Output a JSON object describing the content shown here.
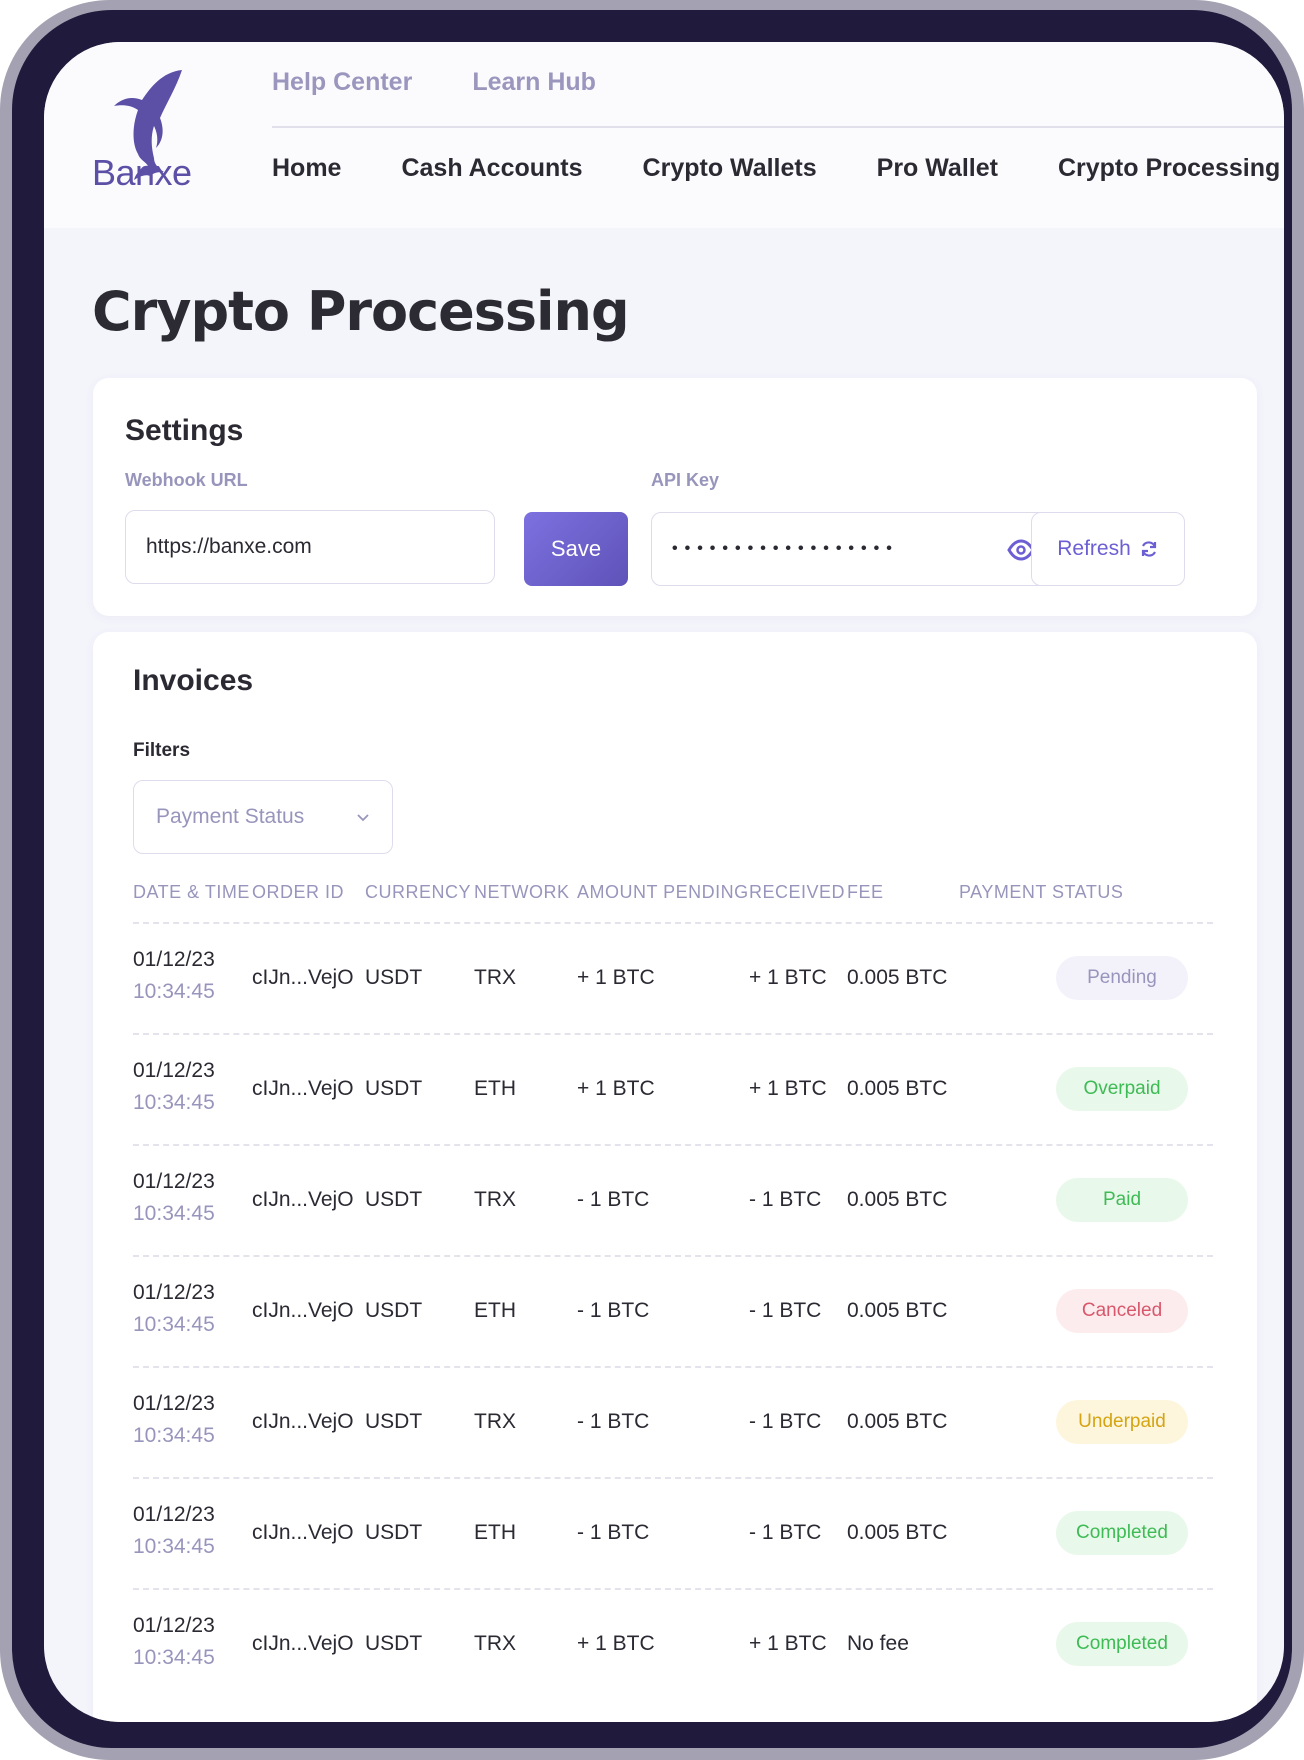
{
  "brand": {
    "name": "Banxe",
    "color": "#5b4fa6"
  },
  "header": {
    "top_links": [
      "Help Center",
      "Learn Hub"
    ],
    "nav": [
      "Home",
      "Cash Accounts",
      "Crypto Wallets",
      "Pro Wallet",
      "Crypto Processing"
    ]
  },
  "page": {
    "title": "Crypto Processing"
  },
  "settings": {
    "title": "Settings",
    "webhook_label": "Webhook URL",
    "webhook_value": "https://banxe.com",
    "save_label": "Save",
    "api_key_label": "API Key",
    "api_key_masked": "••••••••••••••••••",
    "refresh_label": "Refresh"
  },
  "invoices": {
    "title": "Invoices",
    "filters_label": "Filters",
    "filter_select": {
      "placeholder": "Payment Status"
    },
    "columns": [
      "DATE & TIME",
      "ORDER ID",
      "CURRENCY",
      "NETWORK",
      "AMOUNT PENDING",
      "RECEIVED",
      "FEE",
      "PAYMENT STATUS"
    ],
    "rows": [
      {
        "date": "01/12/23",
        "time": "10:34:45",
        "order_id": "cIJn...VejO",
        "currency": "USDT",
        "network": "TRX",
        "amount_pending": "+ 1 BTC",
        "received": "+ 1 BTC",
        "fee": "0.005 BTC",
        "status": "Pending",
        "status_key": "pending"
      },
      {
        "date": "01/12/23",
        "time": "10:34:45",
        "order_id": "cIJn...VejO",
        "currency": "USDT",
        "network": "ETH",
        "amount_pending": "+ 1 BTC",
        "received": "+ 1 BTC",
        "fee": "0.005 BTC",
        "status": "Overpaid",
        "status_key": "success"
      },
      {
        "date": "01/12/23",
        "time": "10:34:45",
        "order_id": "cIJn...VejO",
        "currency": "USDT",
        "network": "TRX",
        "amount_pending": "- 1 BTC",
        "received": "- 1 BTC",
        "fee": "0.005 BTC",
        "status": "Paid",
        "status_key": "success"
      },
      {
        "date": "01/12/23",
        "time": "10:34:45",
        "order_id": "cIJn...VejO",
        "currency": "USDT",
        "network": "ETH",
        "amount_pending": "- 1 BTC",
        "received": "- 1 BTC",
        "fee": "0.005 BTC",
        "status": "Canceled",
        "status_key": "danger"
      },
      {
        "date": "01/12/23",
        "time": "10:34:45",
        "order_id": "cIJn...VejO",
        "currency": "USDT",
        "network": "TRX",
        "amount_pending": "- 1 BTC",
        "received": "- 1 BTC",
        "fee": "0.005 BTC",
        "status": "Underpaid",
        "status_key": "warning"
      },
      {
        "date": "01/12/23",
        "time": "10:34:45",
        "order_id": "cIJn...VejO",
        "currency": "USDT",
        "network": "ETH",
        "amount_pending": "- 1 BTC",
        "received": "- 1 BTC",
        "fee": "0.005 BTC",
        "status": "Completed",
        "status_key": "success"
      },
      {
        "date": "01/12/23",
        "time": "10:34:45",
        "order_id": "cIJn...VejO",
        "currency": "USDT",
        "network": "TRX",
        "amount_pending": "+ 1 BTC",
        "received": "+ 1 BTC",
        "fee": "No fee",
        "status": "Completed",
        "status_key": "success"
      }
    ]
  },
  "status_colors": {
    "pending": {
      "bg": "#f3f2fb",
      "fg": "#9895bc"
    },
    "success": {
      "bg": "#e8f8ea",
      "fg": "#3fbb55"
    },
    "danger": {
      "bg": "#fcecee",
      "fg": "#d9576a"
    },
    "warning": {
      "bg": "#fdf6dc",
      "fg": "#d4a413"
    }
  },
  "accent": "#6c5fd4"
}
